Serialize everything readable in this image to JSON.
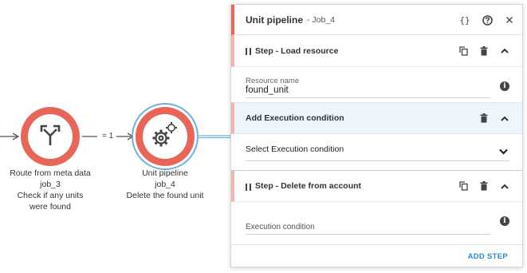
{
  "flow": {
    "nodes": [
      {
        "title": "Route from meta data",
        "id": "job_3",
        "description": "Check if any units were found",
        "icon": "route-split-icon"
      },
      {
        "title": "Unit pipeline",
        "id": "job_4",
        "description": "Delete the found unit",
        "icon": "gears-icon"
      }
    ],
    "edge_label": "= 1"
  },
  "panel": {
    "title": "Unit pipeline",
    "subtitle": "- Job_4",
    "header_icons": [
      "braces-icon",
      "help-icon",
      "close-icon"
    ],
    "steps": [
      {
        "title": "Step - Load resource",
        "field_label": "Resource name",
        "field_value": "found_unit"
      },
      {
        "title": "Add Execution condition",
        "select_value": "Select Execution condition"
      },
      {
        "title": "Step - Delete from account",
        "field_value": "Execution condition"
      }
    ],
    "add_step_label": "ADD STEP"
  },
  "colors": {
    "node": "#e8655a",
    "selection_ring": "#6fb1df",
    "accent_blue": "#2a8ad8",
    "shaded_row": "#eef5fb"
  }
}
